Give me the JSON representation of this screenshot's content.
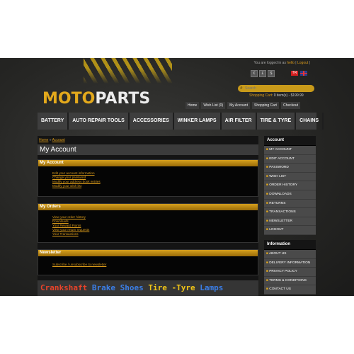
{
  "top": {
    "logged_pre": "You are logged in as",
    "user": "hello",
    "logout": "Logout",
    "currencies": [
      "€",
      "£",
      "$"
    ],
    "flags": [
      {
        "label": "TR",
        "color": "#d21f1f"
      },
      {
        "label": "EN",
        "color": "#2b3f8c"
      }
    ]
  },
  "search": {
    "placeholder": "Search"
  },
  "cart": {
    "label": "Shopping Cart",
    "summary": ": 0 item(s) - $199.99"
  },
  "logo": {
    "part1": "MOTO",
    "part2": "PARTS"
  },
  "header_nav": [
    "Home",
    "Wish List (0)",
    "My Account",
    "Shopping Cart",
    "Checkout"
  ],
  "menu": [
    "BATTERY",
    "AUTO REPAIR TOOLS",
    "ACCESSORIES",
    "WINKER LAMPS",
    "AIR FILTER",
    "TIRE & TYRE",
    "CHAINS"
  ],
  "breadcrumb": {
    "home": "Home",
    "sep": "»",
    "current": "Account"
  },
  "page_title": "My Account",
  "sections": [
    {
      "title": "My Account",
      "links": [
        "Edit your account information",
        "Change your password",
        "Modify your address book entries",
        "Modify your wish list"
      ]
    },
    {
      "title": "My Orders",
      "links": [
        "View your order history",
        "Downloads",
        "Your Reward Points",
        "View your return requests",
        "Your Transactions"
      ]
    },
    {
      "title": "Newsletter",
      "links": [
        "Subscribe / unsubscribe to newsletter"
      ]
    }
  ],
  "banner": [
    {
      "text": "Crankshaft",
      "color": "#e8432a"
    },
    {
      "text": "Brake Shoes",
      "color": "#3b7ee6"
    },
    {
      "text": "Tire -Tyre",
      "color": "#f0c417"
    },
    {
      "text": "Lamps",
      "color": "#3b7ee6"
    }
  ],
  "sidebar_account": {
    "title": "Account",
    "items": [
      "MY ACCOUNT",
      "EDIT ACCOUNT",
      "PASSWORD",
      "WISH LIST",
      "ORDER HISTORY",
      "DOWNLOADS",
      "RETURNS",
      "TRANSACTIONS",
      "NEWSLETTER",
      "LOGOUT"
    ]
  },
  "sidebar_info": {
    "title": "Information",
    "items": [
      "ABOUT US",
      "DELIVERY INFORMATION",
      "PRIVACY POLICY",
      "TERMS & CONDITIONS",
      "CONTACT US"
    ]
  },
  "colors": {
    "accent": "#e3a91c",
    "link": "#d99a1a",
    "background": "#262624"
  }
}
